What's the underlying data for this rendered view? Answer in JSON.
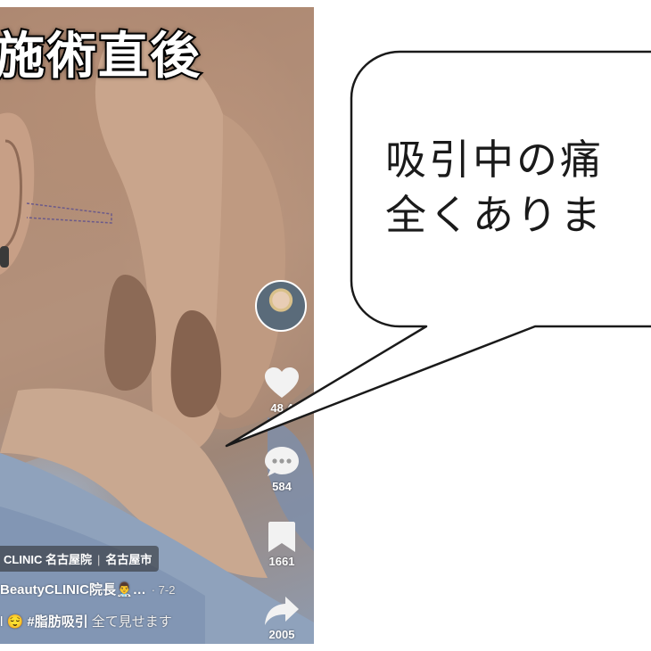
{
  "overlay_title": "施術直後",
  "speech_bubble": {
    "line1": "吸引中の痛",
    "line2": "全くありま"
  },
  "actions": {
    "like_count": "48.4",
    "comment_count": "584",
    "bookmark_count": "1661",
    "share_count": "2005"
  },
  "bottom": {
    "place_name": "CLINIC 名古屋院",
    "place_city": "名古屋市",
    "author": "BeautyCLINIC院長👨‍⚕️…",
    "date": "· 7-2",
    "caption_prefix": "l 😌",
    "caption_hashtag": "#脂肪吸引",
    "caption_more": "全て見せます"
  },
  "icons": {
    "like": "heart-icon",
    "comment": "comment-bubble-icon",
    "bookmark": "bookmark-icon",
    "share": "share-arrow-icon"
  },
  "colors": {
    "overlay_text": "#ffffff",
    "title_outline": "#000000",
    "bubble_stroke": "#1a1a1a",
    "bubble_fill": "#ffffff"
  }
}
